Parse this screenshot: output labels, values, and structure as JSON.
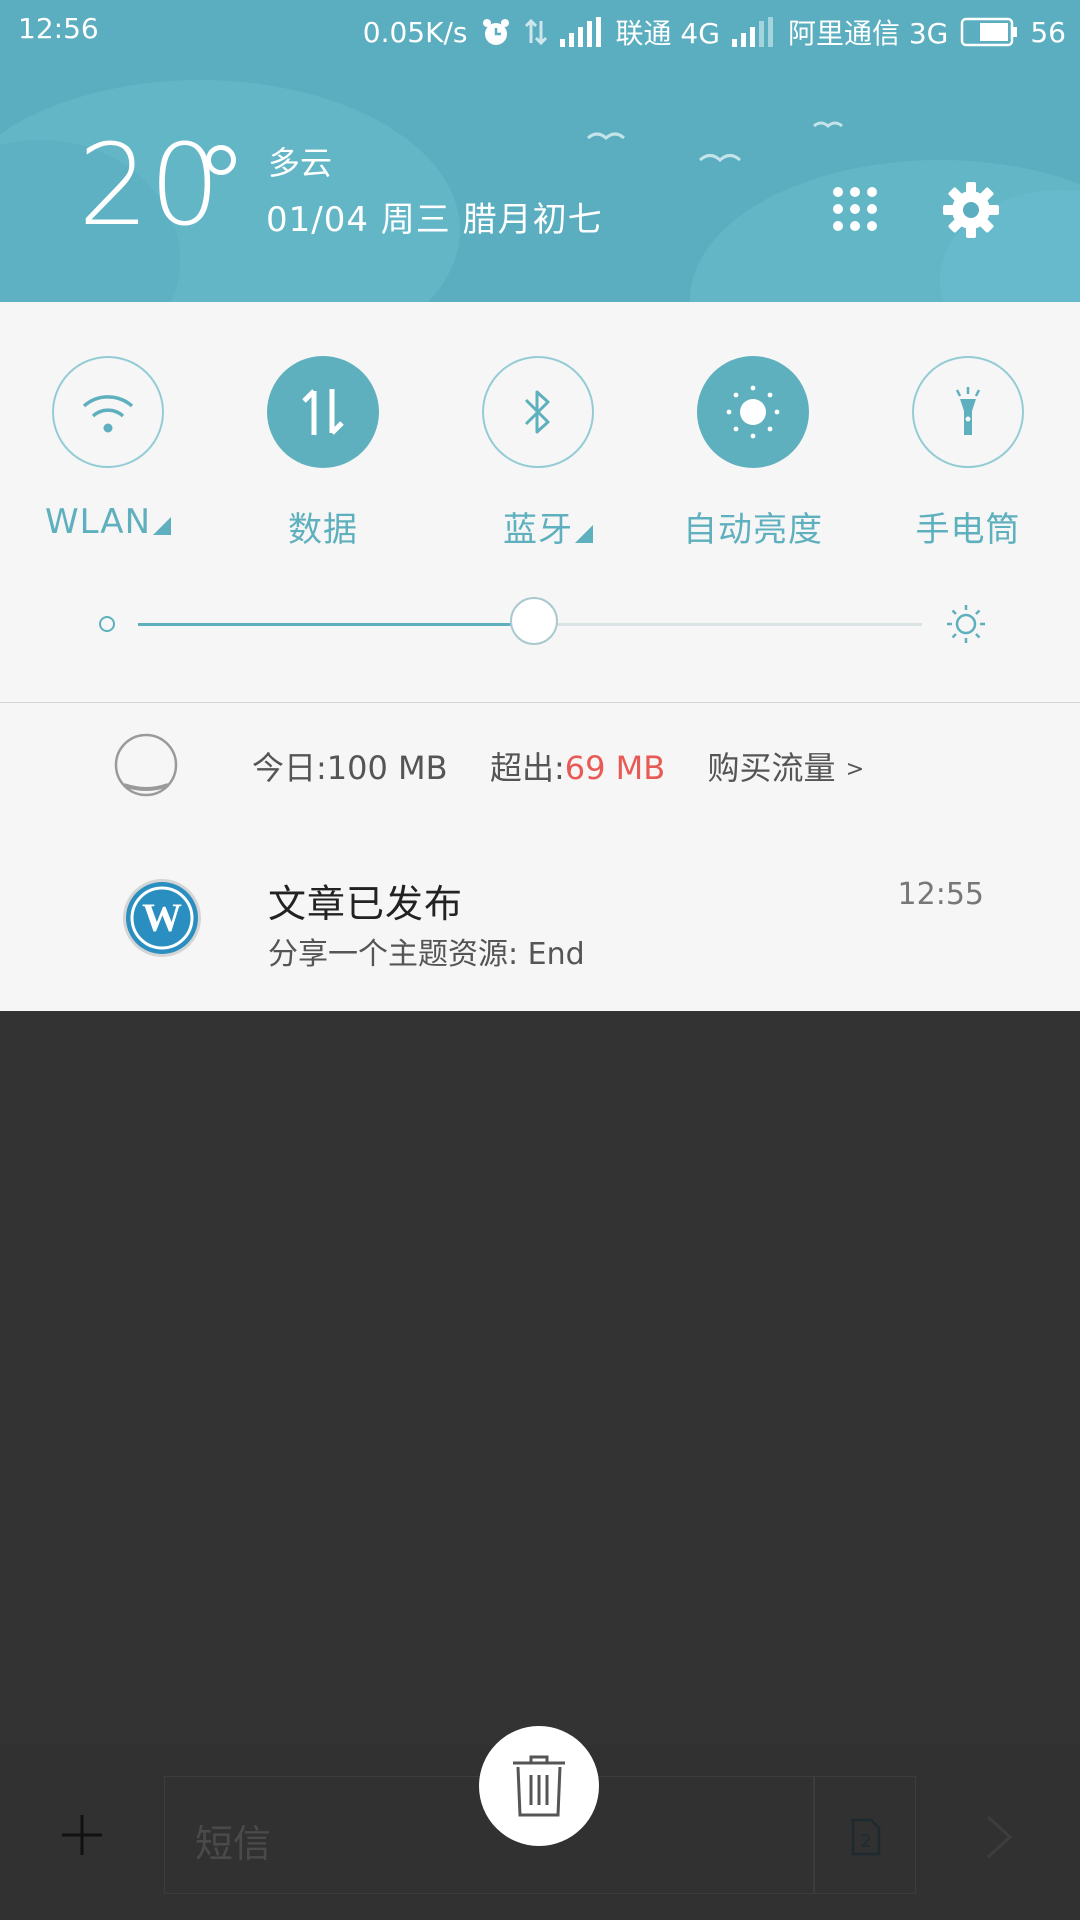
{
  "status_bar": {
    "time": "12:56",
    "speed": "0.05K/s",
    "carrier1": "联通 4G",
    "carrier2": "阿里通信 3G",
    "battery": "56"
  },
  "weather": {
    "temperature": "20",
    "condition": "多云",
    "date": "01/04 周三 腊月初七"
  },
  "quick_settings": [
    {
      "label": "WLAN",
      "icon": "wifi-icon",
      "active": false,
      "expandable": true
    },
    {
      "label": "数据",
      "icon": "mobile-data-icon",
      "active": true,
      "expandable": false
    },
    {
      "label": "蓝牙",
      "icon": "bluetooth-icon",
      "active": false,
      "expandable": true
    },
    {
      "label": "自动亮度",
      "icon": "auto-brightness-icon",
      "active": true,
      "expandable": false
    },
    {
      "label": "手电筒",
      "icon": "flashlight-icon",
      "active": false,
      "expandable": false
    }
  ],
  "brightness": {
    "level": 0.5
  },
  "data_usage": {
    "today_prefix": "今日:",
    "today_value": "100 MB",
    "over_prefix": "超出:",
    "over_value": "69 MB",
    "buy_label": "购买流量",
    "buy_arrow": ">"
  },
  "notification": {
    "title": "文章已发布",
    "body": "分享一个主题资源: End",
    "time": "12:55",
    "app_icon": "wordpress-icon"
  },
  "composer": {
    "placeholder": "短信",
    "sim_slot": "2"
  },
  "colors": {
    "accent": "#5fb0be",
    "header": "#5aaebf",
    "over_value": "#e85a55",
    "background_dark": "#333333"
  }
}
